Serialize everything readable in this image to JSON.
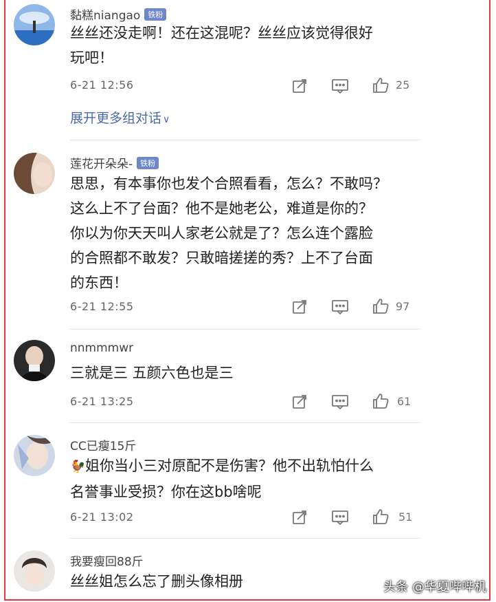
{
  "comments": [
    {
      "username": "黏糕niangao",
      "badge": "铁粉",
      "text": [
        "丝丝还没走啊！还在这混呢？丝丝应该觉得很好",
        "玩吧！"
      ],
      "time": "6-21 12:56",
      "likes": "25",
      "expand": "展开更多组对话",
      "expand_icon": "chevron-down-icon"
    },
    {
      "username": "莲花开朵朵-",
      "badge": "铁粉",
      "text": [
        "思思，有本事你也发个合照看看，怎么？不敢吗？",
        "这么上不了台面？他不是她老公，难道是你的？",
        "你以为你天天叫人家老公就是了？怎么连个露脸",
        "的合照都不敢发？只敢暗搓搓的秀？上不了台面",
        "的东西！"
      ],
      "time": "6-21 12:55",
      "likes": "97"
    },
    {
      "username": "nnmmmwr",
      "text": [
        "三就是三 五颜六色也是三"
      ],
      "time": "6-21 13:25",
      "likes": "61"
    },
    {
      "username": "CC已瘦15斤",
      "emoji_icon": "rooster-emoji-icon",
      "text": [
        "姐你当小三对原配不是伤害？他不出轨怕什么",
        "名誉事业受损？你在这bb啥呢"
      ],
      "time": "6-21 13:02",
      "likes": "51"
    },
    {
      "username": "我要瘦回88斤",
      "text": [
        "丝丝姐怎么忘了删头像相册"
      ]
    }
  ],
  "watermark": "头条 @华夏哔哔机",
  "colors": {
    "border": "#e4393c",
    "badge": "#6f86c8",
    "link": "#4a6ab0"
  }
}
